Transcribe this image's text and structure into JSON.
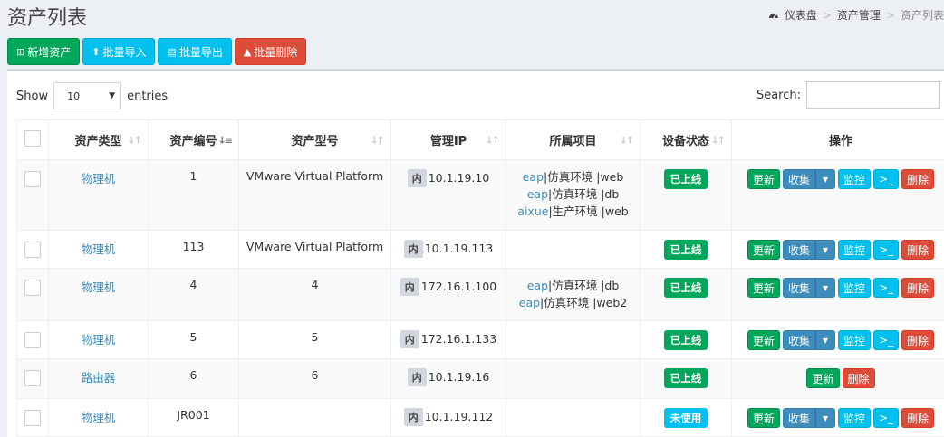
{
  "header": {
    "title": "资产列表",
    "breadcrumb": [
      "仪表盘",
      "资产管理",
      "资产列表"
    ]
  },
  "toolbar": {
    "add": "新增资产",
    "import": "批量导入",
    "export": "批量导出",
    "delete": "批量删除"
  },
  "controls": {
    "show_label": "Show",
    "page_size": "10",
    "entries_label": "entries",
    "search_label": "Search:",
    "search_value": ""
  },
  "table": {
    "headers": [
      "资产类型",
      "资产编号",
      "资产型号",
      "管理IP",
      "所属项目",
      "设备状态",
      "操作"
    ],
    "ip_tag": "内",
    "actions": {
      "update": "更新",
      "collect": "收集",
      "monitor": "监控",
      "terminal": ">_",
      "delete": "删除"
    },
    "rows": [
      {
        "type": "物理机",
        "no": "1",
        "model": "VMware Virtual Platform",
        "ip": "10.1.19.10",
        "projects": [
          {
            "link": "eap",
            "text": "|仿真环境 |web"
          },
          {
            "link": "eap",
            "text": "|仿真环境 |db"
          },
          {
            "link": "aixue",
            "text": "|生产环境 |web"
          }
        ],
        "status": "已上线"
      },
      {
        "type": "物理机",
        "no": "113",
        "model": "VMware Virtual Platform",
        "ip": "10.1.19.113",
        "projects": [],
        "status": "已上线"
      },
      {
        "type": "物理机",
        "no": "4",
        "model": "4",
        "ip": "172.16.1.100",
        "projects": [
          {
            "link": "eap",
            "text": "|仿真环境 |db"
          },
          {
            "link": "eap",
            "text": "|仿真环境 |web2"
          }
        ],
        "status": "已上线"
      },
      {
        "type": "物理机",
        "no": "5",
        "model": "5",
        "ip": "172.16.1.133",
        "projects": [],
        "status": "已上线"
      },
      {
        "type": "路由器",
        "no": "6",
        "model": "6",
        "ip": "10.1.19.16",
        "projects": [],
        "status": "已上线"
      },
      {
        "type": "物理机",
        "no": "JR001",
        "model": "",
        "ip": "10.1.19.112",
        "projects": [],
        "status": "未使用"
      }
    ]
  },
  "colors": {
    "success": "#00a65a",
    "info": "#00c0ef",
    "danger": "#dd4b39",
    "primary": "#3c8dbc"
  }
}
